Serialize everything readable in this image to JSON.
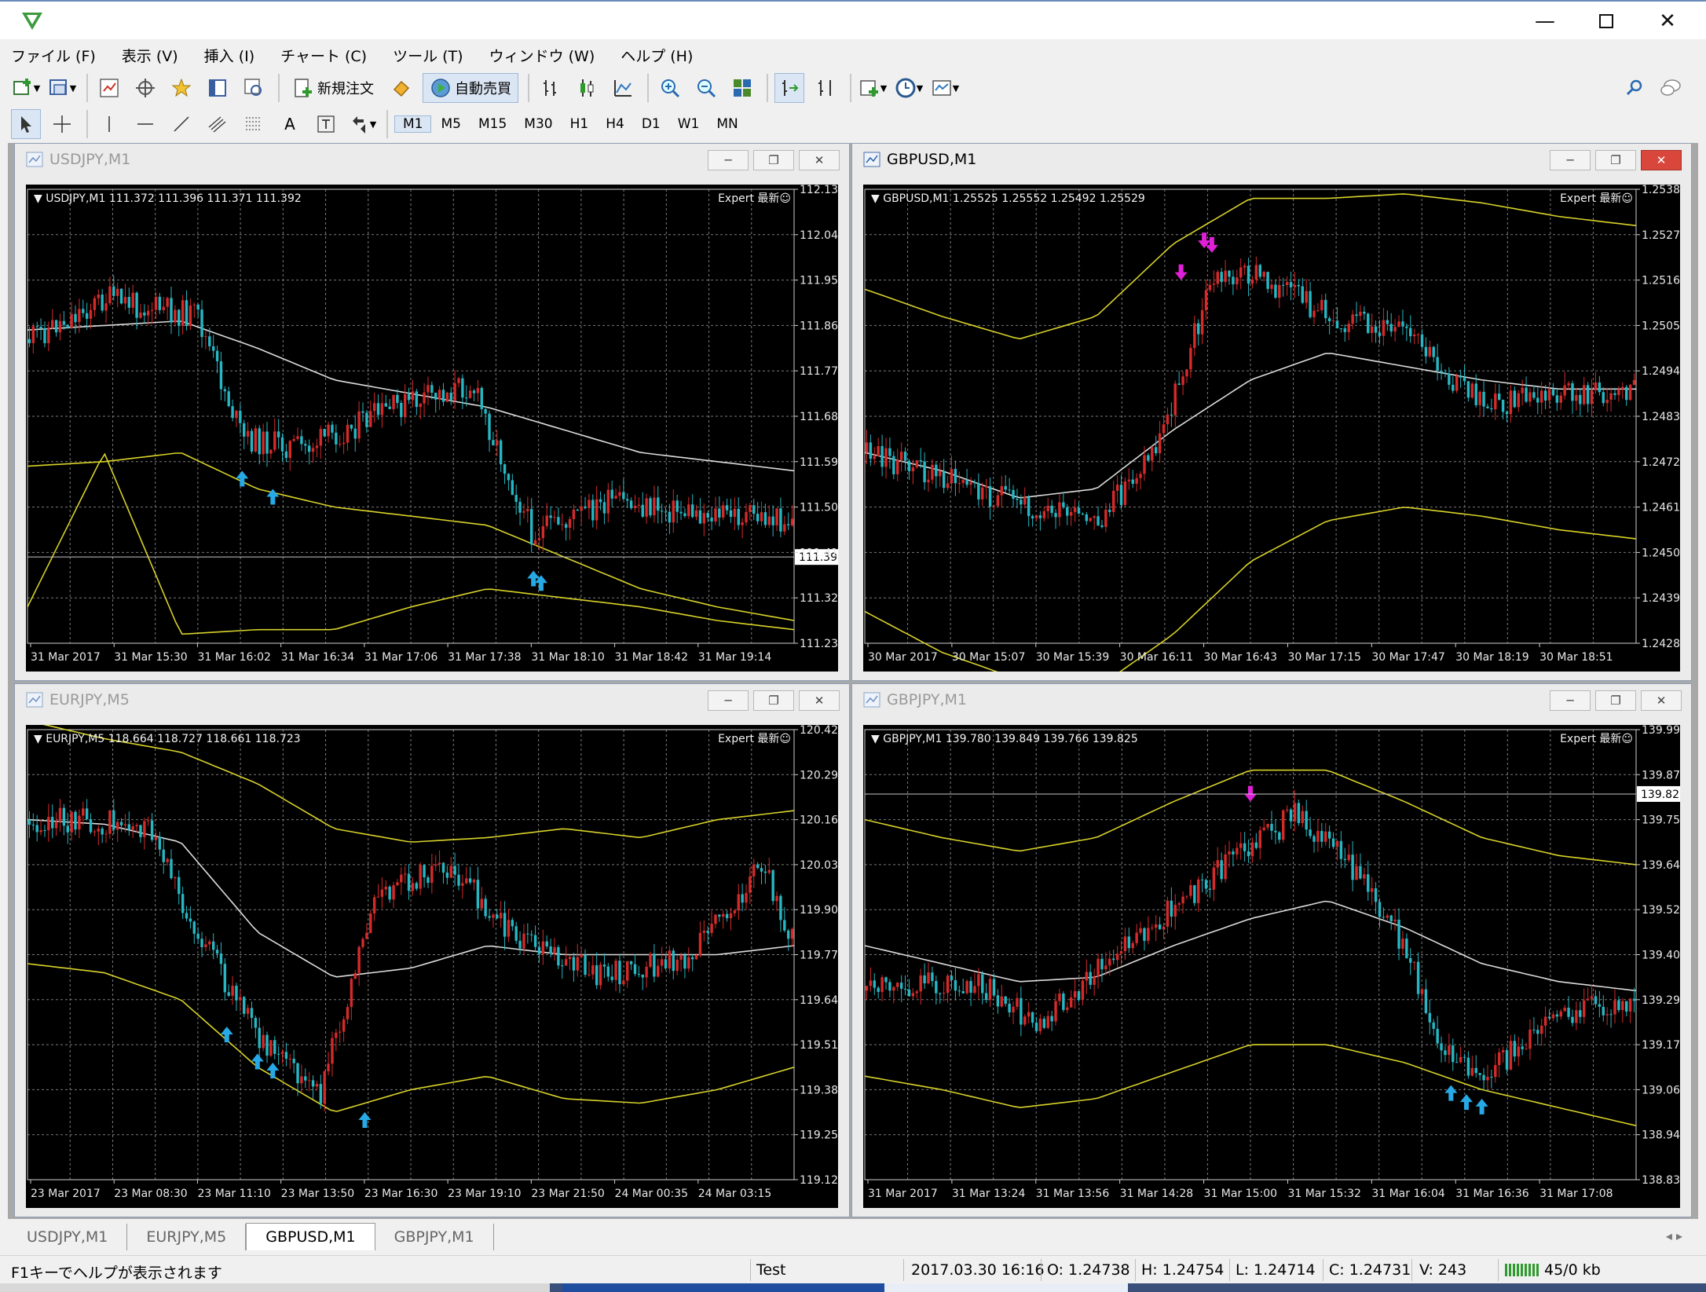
{
  "titlebar": {
    "title": ""
  },
  "menu": [
    "ファイル (F)",
    "表示 (V)",
    "挿入 (I)",
    "チャート (C)",
    "ツール (T)",
    "ウィンドウ (W)",
    "ヘルプ (H)"
  ],
  "toolbar": {
    "new_order": "新規注文",
    "auto_trade": "自動売買"
  },
  "periods": [
    "M1",
    "M5",
    "M15",
    "M30",
    "H1",
    "H4",
    "D1",
    "W1",
    "MN"
  ],
  "active_period": "M1",
  "charts": [
    {
      "title": "USDJPY,M1",
      "info": "USDJPY,M1  111.372 111.396 111.371 111.392",
      "expert": "Expert 最新☺",
      "price_axis": [
        "112.130",
        "112.040",
        "111.950",
        "111.860",
        "111.770",
        "111.680",
        "111.590",
        "111.500",
        "111.410",
        "111.320",
        "111.230"
      ],
      "current_price": "111.392",
      "time_axis": [
        "31 Mar 2017",
        "31 Mar 15:30",
        "31 Mar 16:02",
        "31 Mar 16:34",
        "31 Mar 17:06",
        "31 Mar 17:38",
        "31 Mar 18:10",
        "31 Mar 18:42",
        "31 Mar 19:14"
      ]
    },
    {
      "title": "GBPUSD,M1",
      "info": "GBPUSD,M1  1.25525 1.25552 1.25492 1.25529",
      "expert": "Expert 最新☺",
      "price_axis": [
        "1.25380",
        "1.25270",
        "1.25160",
        "1.25050",
        "1.24940",
        "1.24830",
        "1.24720",
        "1.24610",
        "1.24500",
        "1.24390",
        "1.24280"
      ],
      "current_price": "",
      "time_axis": [
        "30 Mar 2017",
        "30 Mar 15:07",
        "30 Mar 15:39",
        "30 Mar 16:11",
        "30 Mar 16:43",
        "30 Mar 17:15",
        "30 Mar 17:47",
        "30 Mar 18:19",
        "30 Mar 18:51"
      ]
    },
    {
      "title": "EURJPY,M5",
      "info": "EURJPY,M5  118.664 118.727 118.661 118.723",
      "expert": "Expert 最新☺",
      "price_axis": [
        "120.425",
        "120.295",
        "120.160",
        "120.030",
        "119.900",
        "119.770",
        "119.640",
        "119.510",
        "119.380",
        "119.250",
        "119.120"
      ],
      "current_price": "",
      "time_axis": [
        "23 Mar 2017",
        "23 Mar 08:30",
        "23 Mar 11:10",
        "23 Mar 13:50",
        "23 Mar 16:30",
        "23 Mar 19:10",
        "23 Mar 21:50",
        "24 Mar 00:35",
        "24 Mar 03:15"
      ]
    },
    {
      "title": "GBPJPY,M1",
      "info": "GBPJPY,M1  139.780 139.849 139.766 139.825",
      "expert": "Expert 最新☺",
      "price_axis": [
        "139.990",
        "139.875",
        "139.755",
        "139.640",
        "139.525",
        "139.405",
        "139.290",
        "139.175",
        "139.060",
        "138.945",
        "138.830"
      ],
      "current_price": "139.825",
      "time_axis": [
        "31 Mar 2017",
        "31 Mar 13:24",
        "31 Mar 13:56",
        "31 Mar 14:28",
        "31 Mar 15:00",
        "31 Mar 15:32",
        "31 Mar 16:04",
        "31 Mar 16:36",
        "31 Mar 17:08"
      ]
    }
  ],
  "tabs": [
    "USDJPY,M1",
    "EURJPY,M5",
    "GBPUSD,M1",
    "GBPJPY,M1"
  ],
  "active_tab": "GBPUSD,M1",
  "tab_scroll": "◂   ▸",
  "status": {
    "help": "F1キーでヘルプが表示されます",
    "profile": "Test",
    "datetime": "2017.03.30 16:16",
    "open": "O: 1.24738",
    "high": "H: 1.24754",
    "low": "L: 1.24714",
    "close": "C: 1.24731",
    "volume": "V: 243",
    "traffic": "45/0 kb"
  },
  "colors": {
    "chart_bg": "#000000",
    "bull": "#d42a2a",
    "bear": "#27b6c2",
    "band": "#d8d22a",
    "mid": "#dcdcdc",
    "grid": "#7a7a7a",
    "buy_arrow": "#27a9e6",
    "sell_arrow": "#e020d8"
  }
}
